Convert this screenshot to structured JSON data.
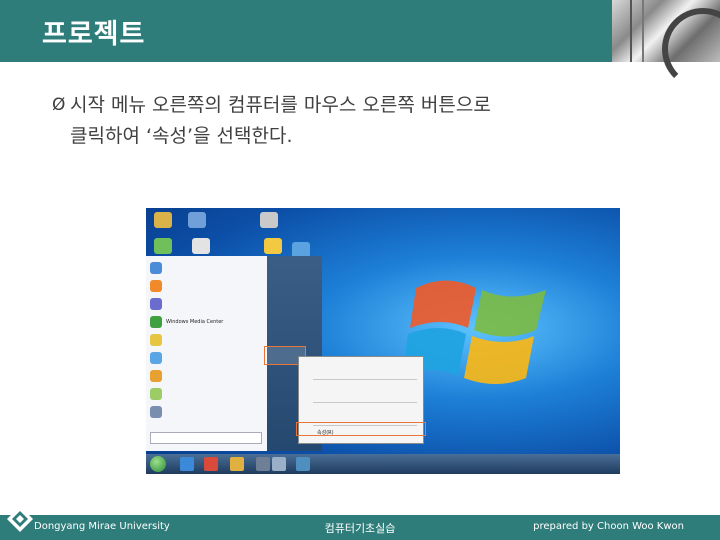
{
  "slide": {
    "title": "프로젝트",
    "bullet_marker": "Ø",
    "body_line1": "시작 메뉴 오른쪽의 컴퓨터를 마우스 오른쪽 버튼으로",
    "body_line2": "클릭하여 ‘속성’을 선택한다."
  },
  "screenshot": {
    "start_menu_items": [
      "Windows Media Center",
      "",
      "",
      "",
      "",
      "",
      "",
      "",
      ""
    ],
    "context_menu": {
      "items": [
        "",
        "",
        "",
        "",
        "",
        "",
        "",
        "속성(R)"
      ]
    }
  },
  "footer": {
    "left": "Dongyang Mirae University",
    "center": "컴퓨터기초실습",
    "right": "prepared by Choon Woo Kwon"
  },
  "colors": {
    "header_bg": "#2e7d7a",
    "highlight": "#e8763a"
  }
}
